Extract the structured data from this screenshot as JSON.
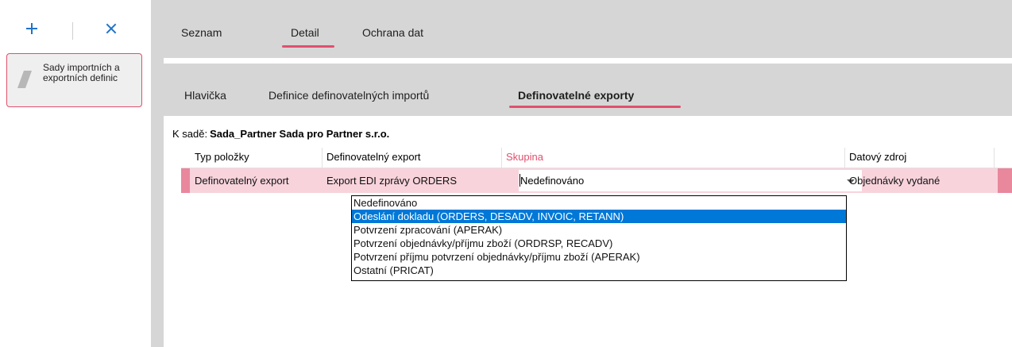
{
  "toolbar": {
    "add_label": "+",
    "close_label": "×"
  },
  "sidebar": {
    "card_label": "Sady importních a exportních definic"
  },
  "tabs": [
    {
      "label": "Seznam"
    },
    {
      "label": "Detail",
      "active": true
    },
    {
      "label": "Ochrana dat"
    }
  ],
  "subtabs": [
    {
      "label": "Hlavička"
    },
    {
      "label": "Definice definovatelných importů"
    },
    {
      "label": "Definovatelné exporty",
      "active": true
    }
  ],
  "set": {
    "label": "K sadě:",
    "value": "Sada_Partner Sada pro Partner s.r.o."
  },
  "table": {
    "columns": [
      {
        "label": "Typ položky"
      },
      {
        "label": "Definovatelný export"
      },
      {
        "label": "Skupina",
        "color": "#e0506e"
      },
      {
        "label": "Datový zdroj"
      }
    ],
    "row": {
      "typ": "Definovatelný export",
      "export": "Export EDI zprávy ORDERS",
      "skupina": "Nedefinováno",
      "zdroj": "Objednávky vydané"
    }
  },
  "dropdown": {
    "options": [
      "Nedefinováno",
      "Odeslání dokladu (ORDERS, DESADV, INVOIC, RETANN)",
      "Potvrzení zpracování (APERAK)",
      "Potvrzení objednávky/příjmu zboží (ORDRSP, RECADV)",
      "Potvrzení příjmu potvrzení objednávky/příjmu zboží (APERAK)",
      "Ostatní (PRICAT)"
    ],
    "selected_index": 1
  },
  "colors": {
    "accent": "#e0506e",
    "icon_blue": "#1f73c9",
    "selection": "#0078d7",
    "row_highlight": "#f8d3dc"
  }
}
